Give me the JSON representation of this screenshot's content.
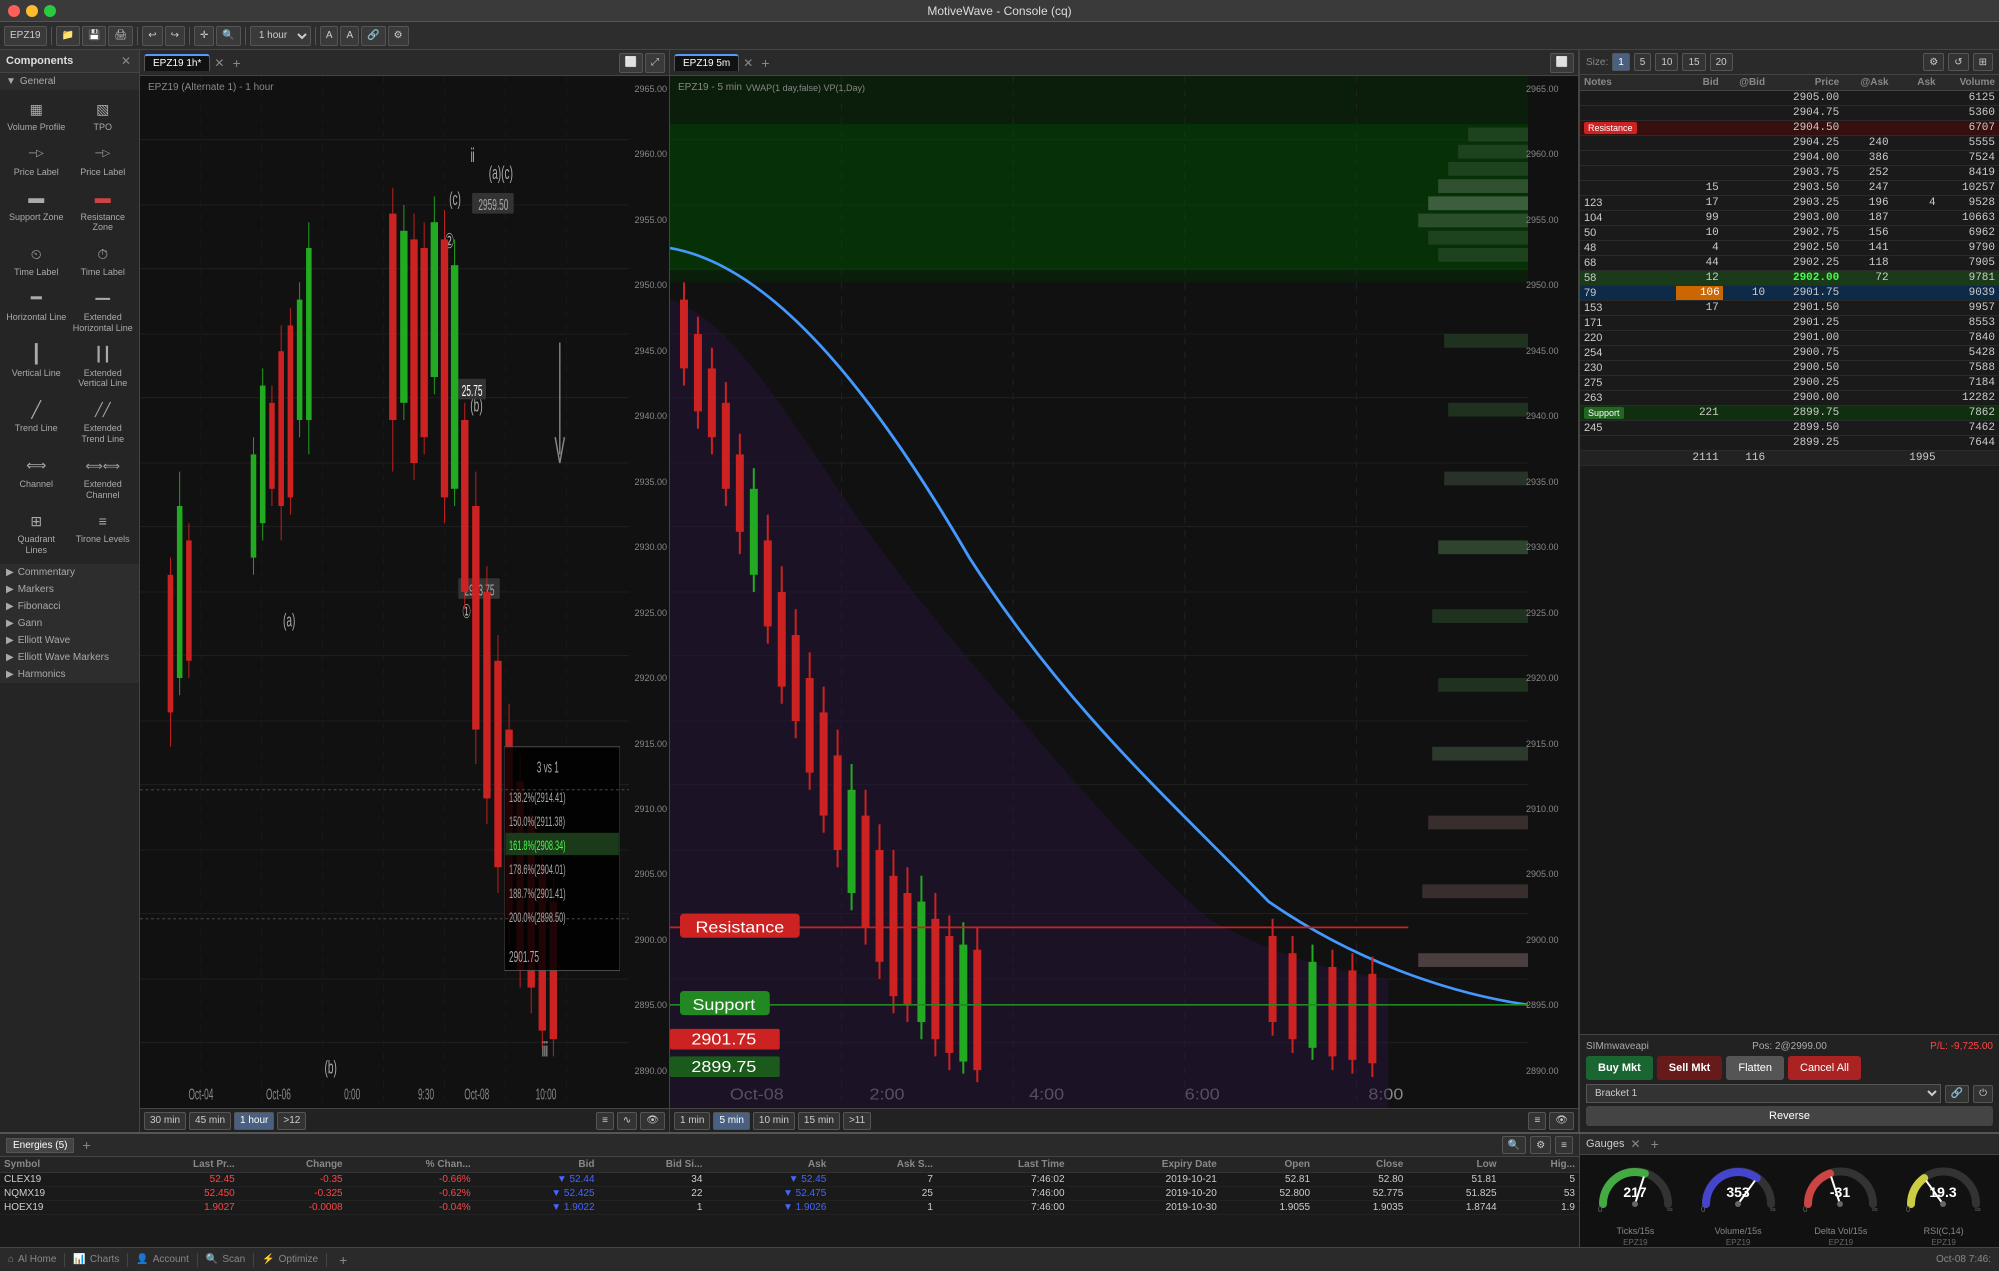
{
  "app": {
    "title": "MotiveWave - Console (cq)"
  },
  "titlebar": {
    "title": "MotiveWave - Console (cq)"
  },
  "components_panel": {
    "title": "Components",
    "sections": [
      {
        "name": "General",
        "items": [
          {
            "id": "volume-profile",
            "label": "Volume Profile",
            "icon": "▦"
          },
          {
            "id": "tpo",
            "label": "TPO",
            "icon": "▧"
          },
          {
            "id": "price-label-1",
            "label": "Price Label",
            "icon": "─◁"
          },
          {
            "id": "price-label-2",
            "label": "Price Label",
            "icon": "─◁"
          },
          {
            "id": "support-zone",
            "label": "Support Zone",
            "icon": "▬"
          },
          {
            "id": "resistance-zone",
            "label": "Resistance Zone",
            "icon": "▬"
          },
          {
            "id": "time-label-1",
            "label": "Time Label",
            "icon": "⌛"
          },
          {
            "id": "time-label-2",
            "label": "Time Label",
            "icon": "⌛"
          },
          {
            "id": "horizontal-line",
            "label": "Horizontal Line",
            "icon": "━"
          },
          {
            "id": "extended-horizontal-line",
            "label": "Extended Horizontal Line",
            "icon": "━━"
          },
          {
            "id": "vertical-line",
            "label": "Vertical Line",
            "icon": "┃"
          },
          {
            "id": "extended-vertical-line",
            "label": "Extended Vertical Line",
            "icon": "┃┃"
          },
          {
            "id": "trend-line",
            "label": "Trend Line",
            "icon": "╱"
          },
          {
            "id": "extended-trend-line",
            "label": "Extended Trend Line",
            "icon": "╱╱"
          },
          {
            "id": "channel",
            "label": "Channel",
            "icon": "⫴"
          },
          {
            "id": "extended-channel",
            "label": "Extended Channel",
            "icon": "⫴⫴"
          },
          {
            "id": "quadrant-lines",
            "label": "Quadrant Lines",
            "icon": "⊞"
          },
          {
            "id": "tirone-levels",
            "label": "Tirone Levels",
            "icon": "≡"
          }
        ]
      },
      {
        "name": "Commentary",
        "items": []
      },
      {
        "name": "Markers",
        "items": []
      },
      {
        "name": "Fibonacci",
        "items": []
      },
      {
        "name": "Gann",
        "items": []
      },
      {
        "name": "Elliott Wave",
        "items": []
      },
      {
        "name": "Elliott Wave Markers",
        "items": []
      },
      {
        "name": "Harmonics",
        "items": []
      }
    ]
  },
  "chart1": {
    "tab": "EPZ19 1h*",
    "title": "EPZ19 (Alternate 1) - 1 hour",
    "timeframes": [
      "30 min",
      "45 min",
      "1 hour",
      ">12"
    ],
    "active_timeframe": "1 hour",
    "wave_labels": [
      "(a)",
      "(b)",
      "(c)",
      "①",
      "②",
      "ⅱ",
      "ⅰ"
    ],
    "price_levels": [
      "2965.00",
      "2960.00",
      "2955.00",
      "2950.00",
      "2945.00",
      "2940.00",
      "2935.00",
      "2930.00",
      "2925.00",
      "2920.00",
      "2915.00",
      "2910.00",
      "2905.00",
      "2900.00",
      "2895.00",
      "2890.00"
    ],
    "fib_levels": [
      {
        "label": "138.2%(2914.41)",
        "value": "2914.41"
      },
      {
        "label": "150.0%(2911.38)",
        "value": "2911.38"
      },
      {
        "label": "161.8%(2908.34)",
        "value": "2908.34",
        "highlight": true
      },
      {
        "label": "178.6%(2904.01)",
        "value": "2904.01"
      },
      {
        "label": "188.7%(2901.41)",
        "value": "2901.41"
      },
      {
        "label": "200.0%(2898.50)",
        "value": "2898.50"
      }
    ],
    "fib_title": "3 vs 1",
    "annotations": [
      {
        "text": "2959.50",
        "type": "price"
      },
      {
        "text": "2933.75",
        "type": "price"
      },
      {
        "text": "25.75",
        "type": "diff"
      },
      {
        "text": "2901.75",
        "type": "price"
      }
    ]
  },
  "chart2": {
    "tab": "EPZ19 5m",
    "title": "EPZ19 - 5 min",
    "timeframes": [
      "1 min",
      "5 min",
      "10 min",
      "15 min",
      ">11"
    ],
    "active_timeframe": "5 min",
    "indicators": [
      "VWAP(1 day,false)",
      "VP(1,Day)"
    ],
    "resistance_label": "Resistance",
    "support_label": "Support",
    "price_levels": [
      "2965.00",
      "2960.00",
      "2955.00",
      "2950.00",
      "2945.00",
      "2940.00",
      "2935.00",
      "2930.00",
      "2925.00",
      "2920.00",
      "2915.00",
      "2910.00",
      "2905.00",
      "2900.00",
      "2895.00",
      "2890.00"
    ],
    "right_prices": [
      "2945.00",
      "2940.00",
      "2935.00",
      "2930.00",
      "2925.00",
      "2920.00",
      "2915.00",
      "2910.00",
      "2905.00",
      "2901.75",
      "2899.75"
    ]
  },
  "order_book": {
    "size_options": [
      "1",
      "5",
      "10",
      "15",
      "20"
    ],
    "active_size": "1",
    "headers": [
      "Notes",
      "Bid",
      "@Bid",
      "Price",
      "@Ask",
      "Ask",
      "Volume"
    ],
    "rows": [
      {
        "notes": "",
        "bid": "",
        "bid_size": "",
        "price": "2905.00",
        "ask_size": "",
        "ask": "",
        "volume": "6125",
        "type": "normal"
      },
      {
        "notes": "",
        "bid": "",
        "bid_size": "",
        "price": "2904.75",
        "ask_size": "",
        "ask": "",
        "volume": "5360",
        "type": "normal"
      },
      {
        "notes": "Resistance",
        "bid": "",
        "bid_size": "",
        "price": "2904.50",
        "ask_size": "",
        "ask": "",
        "volume": "6707",
        "type": "resistance"
      },
      {
        "notes": "",
        "bid": "",
        "bid_size": "",
        "price": "2904.25",
        "ask_size": "240",
        "ask": "",
        "volume": "5555",
        "type": "normal"
      },
      {
        "notes": "",
        "bid": "",
        "bid_size": "",
        "price": "2904.00",
        "ask_size": "386",
        "ask": "",
        "volume": "7524",
        "type": "normal"
      },
      {
        "notes": "",
        "bid": "",
        "bid_size": "",
        "price": "2903.75",
        "ask_size": "252",
        "ask": "",
        "volume": "8419",
        "type": "normal"
      },
      {
        "notes": "",
        "bid": "15",
        "bid_size": "",
        "price": "2903.50",
        "ask_size": "247",
        "ask": "",
        "volume": "10257",
        "type": "normal"
      },
      {
        "notes": "123",
        "bid": "17",
        "bid_size": "",
        "price": "2903.25",
        "ask_size": "196",
        "ask": "4",
        "volume": "9528",
        "type": "normal"
      },
      {
        "notes": "104",
        "bid": "99",
        "bid_size": "",
        "price": "2903.00",
        "ask_size": "187",
        "ask": "",
        "volume": "10663",
        "type": "normal"
      },
      {
        "notes": "50",
        "bid": "10",
        "bid_size": "",
        "price": "2902.75",
        "ask_size": "156",
        "ask": "",
        "volume": "6962",
        "type": "normal"
      },
      {
        "notes": "48",
        "bid": "4",
        "bid_size": "",
        "price": "2902.50",
        "ask_size": "141",
        "ask": "",
        "volume": "9790",
        "type": "normal"
      },
      {
        "notes": "68",
        "bid": "44",
        "bid_size": "",
        "price": "2902.25",
        "ask_size": "118",
        "ask": "",
        "volume": "7905",
        "type": "normal"
      },
      {
        "notes": "58",
        "bid": "12",
        "bid_size": "",
        "price": "2902.00",
        "ask_size": "72",
        "ask": "",
        "volume": "9781",
        "type": "current",
        "highlight": true
      },
      {
        "notes": "79",
        "bid": "106",
        "bid_size": "10",
        "price": "2901.75",
        "ask_size": "",
        "ask": "",
        "volume": "9039",
        "type": "bid_highlight"
      },
      {
        "notes": "153",
        "bid": "17",
        "bid_size": "",
        "price": "2901.50",
        "ask_size": "",
        "ask": "",
        "volume": "9957",
        "type": "normal"
      },
      {
        "notes": "171",
        "bid": "",
        "bid_size": "",
        "price": "2901.25",
        "ask_size": "",
        "ask": "",
        "volume": "8553",
        "type": "normal"
      },
      {
        "notes": "220",
        "bid": "",
        "bid_size": "",
        "price": "2901.00",
        "ask_size": "",
        "ask": "",
        "volume": "7840",
        "type": "normal"
      },
      {
        "notes": "254",
        "bid": "",
        "bid_size": "",
        "price": "2900.75",
        "ask_size": "",
        "ask": "",
        "volume": "5428",
        "type": "normal"
      },
      {
        "notes": "230",
        "bid": "",
        "bid_size": "",
        "price": "2900.50",
        "ask_size": "",
        "ask": "",
        "volume": "7588",
        "type": "normal"
      },
      {
        "notes": "275",
        "bid": "",
        "bid_size": "",
        "price": "2900.25",
        "ask_size": "",
        "ask": "",
        "volume": "7184",
        "type": "normal"
      },
      {
        "notes": "263",
        "bid": "",
        "bid_size": "",
        "price": "2900.00",
        "ask_size": "",
        "ask": "",
        "volume": "12282",
        "type": "normal"
      },
      {
        "notes": "Support",
        "bid": "221",
        "bid_size": "",
        "price": "2899.75",
        "ask_size": "",
        "ask": "",
        "volume": "7862",
        "type": "support"
      },
      {
        "notes": "245",
        "bid": "",
        "bid_size": "",
        "price": "2899.50",
        "ask_size": "",
        "ask": "",
        "volume": "7462",
        "type": "normal"
      },
      {
        "notes": "",
        "bid": "",
        "bid_size": "",
        "price": "2899.25",
        "ask_size": "",
        "ask": "",
        "volume": "7644",
        "type": "normal"
      }
    ],
    "summary_row": {
      "bid": "2111",
      "bid_size": "116",
      "price": "",
      "ask_size": "",
      "ask": "1995",
      "volume": ""
    },
    "account": "SIMmwaveapi",
    "position": "Pos: 2@2999.00",
    "pnl": "P/L: -9,725.00"
  },
  "trading": {
    "buy_label": "Buy Mkt",
    "sell_label": "Sell Mkt",
    "flatten_label": "Flatten",
    "cancel_label": "Cancel All",
    "reverse_label": "Reverse",
    "bracket_label": "Bracket 1"
  },
  "watchlist": {
    "title": "Energies (5)",
    "headers": [
      "Symbol",
      "Last Pr...",
      "Change",
      "% Chan...",
      "Bid",
      "Bid Si...",
      "Ask",
      "Ask S...",
      "Last Time",
      "Expiry Date",
      "Open",
      "Close",
      "Low",
      "Hig..."
    ],
    "rows": [
      {
        "symbol": "CLEX19",
        "last": "52.45",
        "change": "-0.35",
        "pct_change": "-0.66%",
        "bid": "52.44",
        "bid_size": "34",
        "ask": "52.45",
        "ask_size": "7",
        "last_time": "7:46:02",
        "expiry": "2019-10-21",
        "open": "52.81",
        "close": "52.80",
        "low": "51.81",
        "high": "5"
      },
      {
        "symbol": "NQMX19",
        "last": "52.450",
        "change": "-0.325",
        "pct_change": "-0.62%",
        "bid": "52.425",
        "bid_size": "22",
        "ask": "52.475",
        "ask_size": "25",
        "last_time": "7:46:00",
        "expiry": "2019-10-20",
        "open": "52.800",
        "close": "52.775",
        "low": "51.825",
        "high": "53"
      },
      {
        "symbol": "HOEX19",
        "last": "1.9027",
        "change": "-0.0008",
        "pct_change": "-0.04%",
        "bid": "1.9022",
        "bid_size": "1",
        "ask": "1.9026",
        "ask_size": "1",
        "last_time": "7:46:00",
        "expiry": "2019-10-30",
        "open": "1.9055",
        "close": "1.9035",
        "low": "1.8744",
        "high": "1.9"
      }
    ]
  },
  "gauges": {
    "title": "Gauges",
    "items": [
      {
        "label": "217",
        "sublabel": "Ticks/15s\nEPZ19",
        "color": "#44aa44",
        "value": 60
      },
      {
        "label": "353",
        "sublabel": "Volume/15s\nEPZ19",
        "color": "#4444aa",
        "value": 70
      },
      {
        "label": "-31",
        "sublabel": "Delta Vol/15s\nEPZ19",
        "color": "#aa4444",
        "value": 40
      },
      {
        "label": "19.3",
        "sublabel": "RSI(C,14)\nEPZ19",
        "color": "#aaaa44",
        "value": 30
      }
    ]
  },
  "statusbar": {
    "items": [
      {
        "icon": "⌂",
        "label": "Al Home"
      },
      {
        "icon": "📊",
        "label": "Charts"
      },
      {
        "icon": "👤",
        "label": "Account"
      },
      {
        "icon": "🔍",
        "label": "Scan"
      },
      {
        "icon": "⚡",
        "label": "Optimize"
      },
      {
        "icon": "+",
        "label": ""
      }
    ],
    "date_time": "Oct-08 7:46:"
  }
}
